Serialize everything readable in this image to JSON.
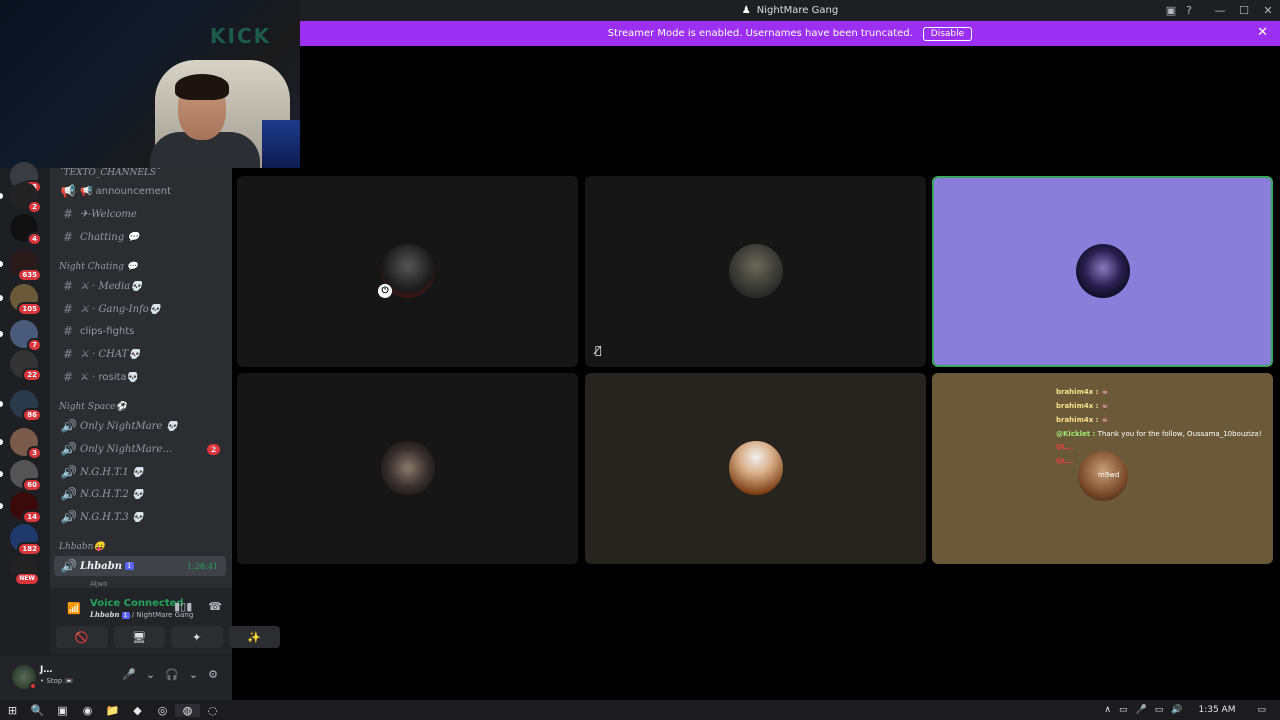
{
  "window": {
    "title": "NightMare Gang",
    "controls": {
      "minimize": "—",
      "maximize": "☐",
      "close": "✕"
    },
    "tools": {
      "inbox": "▣",
      "help": "?"
    }
  },
  "banner": {
    "text": "Streamer Mode is enabled. Usernames have been truncated.",
    "button": "Disable",
    "close": "✕"
  },
  "webcam": {
    "sign": "KICK"
  },
  "servers": [
    {
      "badge": "63"
    },
    {
      "badge": "2"
    },
    {
      "badge": "4"
    },
    {
      "badge": "635"
    },
    {
      "badge": "105"
    },
    {
      "badge": "7"
    },
    {
      "badge": "22"
    },
    {
      "badge": "86"
    },
    {
      "badge": "3"
    },
    {
      "badge": "60"
    },
    {
      "badge": "14"
    },
    {
      "badge": "182"
    },
    {
      "badge": "NEW"
    }
  ],
  "channels": {
    "categories": {
      "texto": "˚TEXTO_CHANNELS˚",
      "night_chating": "Night Chating 💬",
      "night_space": "Night Space⚽",
      "lhbabn": "Lhbabn😛"
    },
    "items": [
      {
        "icon": "📢",
        "name": "📢 announcement"
      },
      {
        "icon": "#",
        "name": "✈-Welcome"
      },
      {
        "icon": "#",
        "name": "Chatting 💬"
      },
      {
        "icon": "#",
        "name": "⚔ · Media💀"
      },
      {
        "icon": "#",
        "name": "⚔ · Gang-Info💀"
      },
      {
        "icon": "#",
        "name": "clips-fights"
      },
      {
        "icon": "#",
        "name": "⚔ · CHAT💀"
      },
      {
        "icon": "#",
        "name": "⚔ · rosita💀"
      },
      {
        "icon": "🔊",
        "name": "Only NightMare 💀"
      },
      {
        "icon": "🔊",
        "name": "Only NightMare…",
        "mentions": "2"
      },
      {
        "icon": "🔊",
        "name": "N.G.H.T.1 💀"
      },
      {
        "icon": "🔊",
        "name": "N.G.H.T.2 💀"
      },
      {
        "icon": "🔊",
        "name": "N.G.H.T.3 💀"
      },
      {
        "icon": "🔊",
        "name": "Lhbabn",
        "tag": "1",
        "time": "1:28:41"
      }
    ],
    "subuser": "Ațwo"
  },
  "voice": {
    "status": "Voice Connected",
    "channel": "Lhbabn",
    "tag": "1",
    "server": "/ NightMare Gang",
    "buttons": [
      "🚫",
      "🖥",
      "✦",
      "✨"
    ],
    "icons": [
      "📶",
      "☎"
    ]
  },
  "user": {
    "name": "J…",
    "status": "• Stop 📼",
    "icons": [
      "🎤",
      "⌄",
      "🎧",
      "⌄",
      "⚙"
    ]
  },
  "chat_overlay": [
    {
      "user": "brahim4x :",
      "msg": "💩"
    },
    {
      "user": "brahim4x :",
      "msg": "💩"
    },
    {
      "user": "brahim4x :",
      "msg": "💩"
    },
    {
      "user": "@Kicklet :",
      "msg": "Thank you for the follow, Oussama_10bouziza!"
    },
    {
      "user": "QL…",
      "msg": ""
    },
    {
      "user": "QL…",
      "msg": ""
    },
    {
      "user": "",
      "msg": "m9wd"
    }
  ],
  "taskbar": {
    "apps": [
      "⊞",
      "🔍",
      "▣",
      "◉",
      "📁",
      "◆",
      "◎",
      "◍",
      "◌"
    ],
    "time": "1:35 AM",
    "tray": [
      "∧",
      "▭",
      "🎤",
      "▭",
      "🔊"
    ]
  },
  "colors": {
    "accent": "#9b30f2",
    "speaking": "#3ba55d",
    "badge": "#da373c",
    "connected": "#23a55a"
  }
}
